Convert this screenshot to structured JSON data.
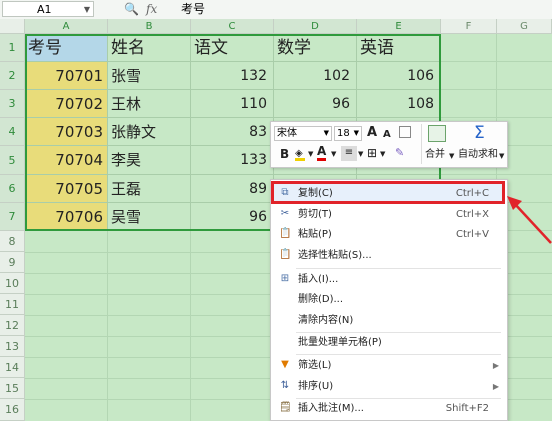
{
  "formula_bar": {
    "cell_ref": "A1",
    "fx": "fx",
    "content": "考号"
  },
  "columns": [
    "A",
    "B",
    "C",
    "D",
    "E",
    "F",
    "G"
  ],
  "rows": [
    "1",
    "2",
    "3",
    "4",
    "5",
    "6",
    "7",
    "8",
    "9",
    "10",
    "11",
    "12",
    "13",
    "14",
    "15",
    "16"
  ],
  "table": {
    "headers": [
      "考号",
      "姓名",
      "语文",
      "数学",
      "英语"
    ],
    "rows": [
      [
        "70701",
        "张雪",
        "132",
        "102",
        "106"
      ],
      [
        "70702",
        "王林",
        "110",
        "96",
        "108"
      ],
      [
        "70703",
        "张静文",
        "83",
        "",
        ""
      ],
      [
        "70704",
        "李昊",
        "133",
        "",
        ""
      ],
      [
        "70705",
        "王磊",
        "89",
        "",
        ""
      ],
      [
        "70706",
        "吴雪",
        "96",
        "",
        ""
      ]
    ]
  },
  "mini_toolbar": {
    "font": "宋体",
    "size": "18",
    "grow": "A",
    "shrink": "A",
    "bold": "B",
    "font_color": "A",
    "merge": "合并",
    "autosum": "自动求和",
    "sigma": "Σ"
  },
  "context_menu": {
    "items": [
      {
        "label": "复制(C)",
        "shortcut": "Ctrl+C",
        "icon": "copy-icon"
      },
      {
        "label": "剪切(T)",
        "shortcut": "Ctrl+X",
        "icon": "scissors-icon"
      },
      {
        "label": "粘贴(P)",
        "shortcut": "Ctrl+V",
        "icon": "paste-icon"
      },
      {
        "label": "选择性粘贴(S)...",
        "shortcut": "",
        "icon": "paste-special-icon"
      },
      {
        "label": "插入(I)...",
        "shortcut": "",
        "icon": "insert-icon"
      },
      {
        "label": "删除(D)...",
        "shortcut": "",
        "icon": ""
      },
      {
        "label": "清除内容(N)",
        "shortcut": "",
        "icon": ""
      },
      {
        "label": "批量处理单元格(P)",
        "shortcut": "",
        "icon": ""
      },
      {
        "label": "筛选(L)",
        "shortcut": "",
        "icon": "filter-icon"
      },
      {
        "label": "排序(U)",
        "shortcut": "",
        "icon": "sort-icon"
      },
      {
        "label": "插入批注(M)...",
        "shortcut": "Shift+F2",
        "icon": "comment-icon"
      }
    ]
  },
  "colors": {
    "header_fill": "#b4d7e8",
    "id_fill": "#e8dc7a",
    "sheet_bg": "#c7e8c6",
    "highlight": "#e1232a"
  }
}
